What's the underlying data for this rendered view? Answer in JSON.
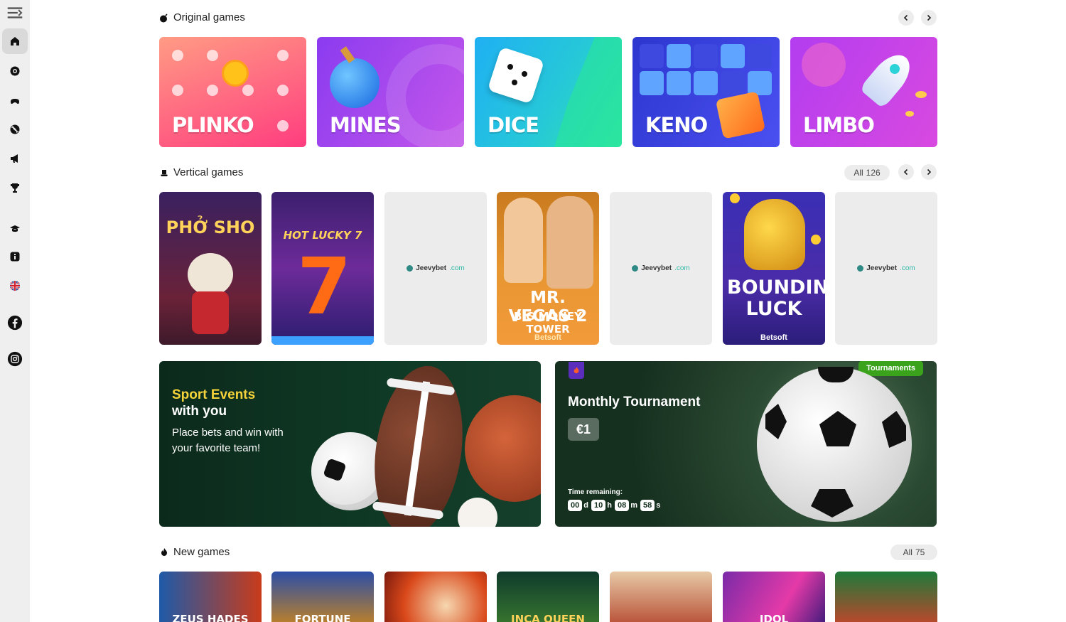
{
  "sidebar": {
    "items": [
      "menu-icon",
      "home-icon",
      "casino-chip-icon",
      "joystick-icon",
      "sport-ball-icon",
      "promo-megaphone-icon",
      "trophy-icon",
      "vip-hat-icon",
      "info-icon",
      "uk-flag-icon",
      "facebook-icon",
      "instagram-icon"
    ]
  },
  "original_games": {
    "title": "Original games",
    "items": [
      {
        "name": "PLINKO",
        "color_from": "#ff8c7a",
        "color_to": "#ff3e7a"
      },
      {
        "name": "MINES",
        "color_from": "#9a4df2",
        "color_to": "#c054e8"
      },
      {
        "name": "DICE",
        "color_from": "#24b7f0",
        "color_to": "#33e0b0"
      },
      {
        "name": "KENO",
        "color_from": "#3540d8",
        "color_to": "#4a55f0"
      },
      {
        "name": "LIMBO",
        "color_from": "#b93cf0",
        "color_to": "#d84ae2"
      }
    ]
  },
  "vertical_games": {
    "title": "Vertical games",
    "all_label": "All",
    "count": "126",
    "items": [
      {
        "title": "PHỞ SHO",
        "provider": ""
      },
      {
        "title": "HOT LUCKY 7",
        "provider": ""
      },
      {
        "brand": "Jeevybet",
        "brand_suffix": ".com"
      },
      {
        "title": "MR. VEGAS 2",
        "subtitle": "BIG MONEY TOWER",
        "provider": "Betsoft"
      },
      {
        "brand": "Jeevybet",
        "brand_suffix": ".com"
      },
      {
        "title": "BOUNDING LUCK",
        "provider": "Betsoft"
      },
      {
        "brand": "Jeevybet",
        "brand_suffix": ".com"
      }
    ]
  },
  "sport_banner": {
    "line1": "Sport Events",
    "line2": "with you",
    "description": "Place bets and win with your favorite team!"
  },
  "tournament_banner": {
    "badge": "Tournaments",
    "title": "Monthly Tournament",
    "prize": "€1",
    "time_label": "Time remaining:",
    "days": "00",
    "days_unit": "d",
    "hours": "10",
    "hours_unit": "h",
    "minutes": "08",
    "minutes_unit": "m",
    "seconds": "58",
    "seconds_unit": "s"
  },
  "new_games": {
    "title": "New games",
    "all_label": "All",
    "count": "75",
    "items": [
      "ZEUS HADES",
      "FORTUNE",
      "",
      "INCA QUEEN",
      "",
      "IDOL",
      ""
    ]
  }
}
